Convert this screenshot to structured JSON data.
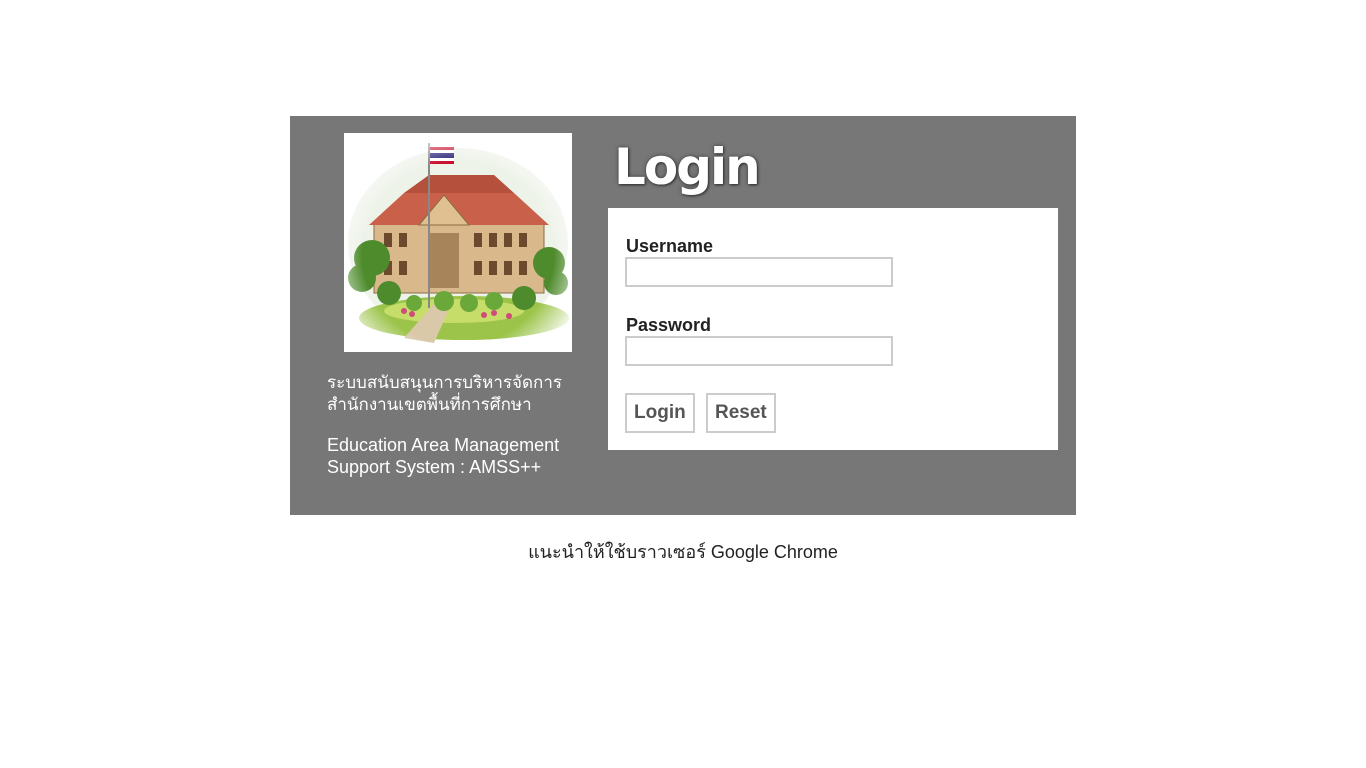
{
  "system": {
    "thai_line1": "ระบบสนับสนุนการบริหารจัดการ",
    "thai_line2": "สำนักงานเขตพื้นที่การศึกษา",
    "en_line1": "Education Area Management",
    "en_line2": "Support System : AMSS++"
  },
  "login_logo_text": "Login",
  "form": {
    "username_label": "Username",
    "username_value": "",
    "password_label": "Password",
    "password_value": "",
    "login_button": "Login",
    "reset_button": "Reset"
  },
  "footer_note": "แนะนำให้ใช้บราวเซอร์ Google Chrome",
  "colors": {
    "panel_bg": "#777777",
    "form_bg": "#ffffff",
    "input_border": "#cccccc",
    "text_dark": "#222222"
  },
  "icons": {
    "photo": "school-building-illustration"
  }
}
